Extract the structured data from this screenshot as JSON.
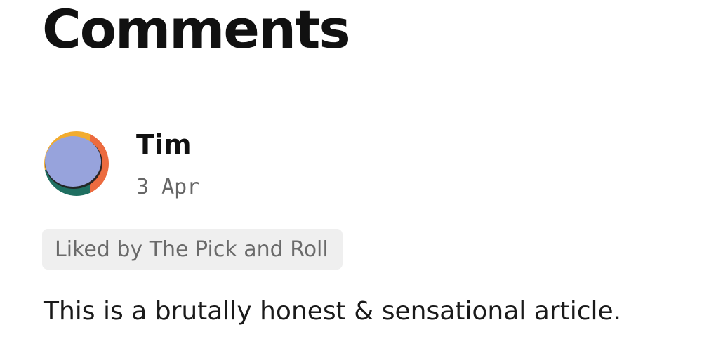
{
  "page": {
    "title": "Comments"
  },
  "comments": [
    {
      "author": "Tim",
      "date": "3 Apr",
      "liked_by": "Liked by The Pick and Roll",
      "text": "This is a brutally honest & sensational article.",
      "avatar": {
        "icon": "user-avatar-icon",
        "colors": {
          "face": "#97a3dc",
          "top_accent": "#f2ac2f",
          "right_accent": "#ec6b3f",
          "bottom_accent": "#1f6f61",
          "shadow": "#222222"
        }
      }
    }
  ]
}
